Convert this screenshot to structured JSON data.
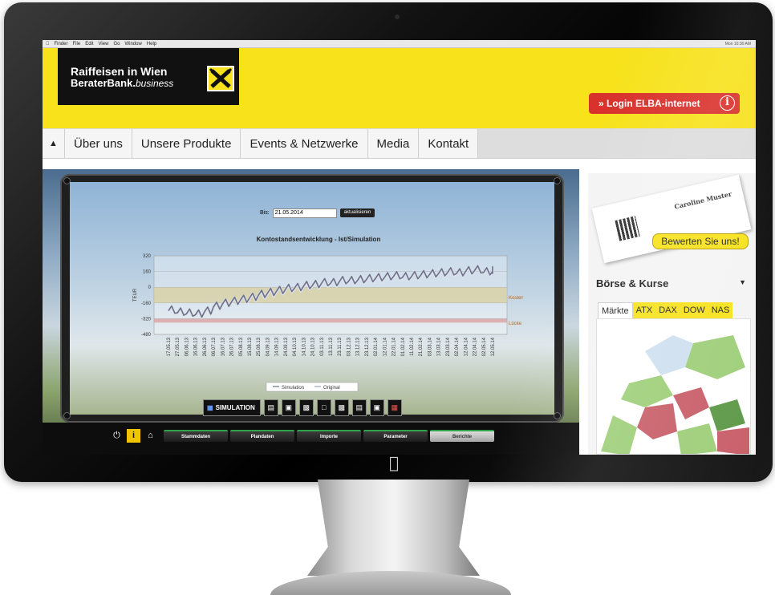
{
  "menubar": {
    "items": [
      "Finder",
      "File",
      "Edit",
      "View",
      "Go",
      "Window",
      "Help"
    ],
    "status": "Mon 10:30 AM"
  },
  "header": {
    "logo_line1": "Raiffeisen in Wien",
    "logo_line2_bold": "BeraterBank.",
    "logo_line2_italic": "business",
    "login_label": "» Login ELBA-internet",
    "info_icon": "i"
  },
  "nav": {
    "home_icon": "home-icon",
    "items": [
      "Über uns",
      "Unsere Produkte",
      "Events & Netzwerke",
      "Media",
      "Kontakt"
    ]
  },
  "simulation": {
    "date_label": "Bis:",
    "date_value": "21.05.2014",
    "update_label": "aktualisieren",
    "sim_button_label": "SIMULATION",
    "tabs": [
      "Stammdaten",
      "Plandaten",
      "Importe",
      "Parameter",
      "Berichte"
    ],
    "active_tab": "Berichte"
  },
  "chart_data": {
    "type": "line",
    "title": "Kontostandsentwicklung - Ist/Simulation",
    "ylabel": "TEUR",
    "xlabel": "",
    "ylim": [
      -480,
      320
    ],
    "yticks": [
      320,
      160,
      0,
      -160,
      -320,
      -480
    ],
    "x": [
      "17.05.13",
      "27.05.13",
      "06.06.13",
      "16.06.13",
      "26.06.13",
      "06.07.13",
      "16.07.13",
      "26.07.13",
      "05.08.13",
      "15.08.13",
      "25.08.13",
      "04.09.13",
      "14.09.13",
      "24.09.13",
      "04.10.13",
      "14.10.13",
      "24.10.13",
      "03.11.13",
      "13.11.13",
      "23.11.13",
      "03.12.13",
      "13.12.13",
      "23.12.13",
      "02.01.14",
      "12.01.14",
      "22.01.14",
      "01.02.14",
      "11.02.14",
      "21.02.14",
      "03.03.14",
      "13.03.14",
      "23.03.14",
      "02.04.14",
      "12.04.14",
      "22.04.14",
      "02.05.14",
      "12.05.14"
    ],
    "series": [
      {
        "name": "Simulation",
        "values": [
          -240,
          -260,
          -270,
          -280,
          -250,
          -200,
          -170,
          -150,
          -130,
          -110,
          -80,
          -60,
          -40,
          -20,
          -10,
          10,
          20,
          40,
          40,
          60,
          60,
          70,
          80,
          90,
          100,
          110,
          100,
          110,
          120,
          130,
          140,
          150,
          140,
          160,
          170,
          150,
          160
        ]
      },
      {
        "name": "Original",
        "values": [
          -245,
          -265,
          -275,
          -285,
          -255,
          -205,
          -175,
          -155,
          -135,
          -115,
          -85,
          -65,
          -45,
          -25,
          -15,
          5,
          15,
          35,
          35,
          55,
          55,
          65,
          75,
          85,
          95,
          105,
          95,
          105,
          115,
          125,
          135,
          145,
          135,
          155,
          165,
          145,
          155
        ]
      }
    ],
    "bands": [
      {
        "label": "Kosten",
        "from": -160,
        "to": 0,
        "color": "#d9c98a"
      },
      {
        "label": "Lücke",
        "from": -360,
        "to": -320,
        "color": "#d98a8a"
      }
    ],
    "grid": true,
    "legend": "bottom"
  },
  "right": {
    "rate_label": "Bewerten Sie uns!",
    "card_name": "Caroline Muster",
    "boerse_title": "Börse & Kurse",
    "boerse_tabs": [
      "Märkte",
      "ATX",
      "DAX",
      "DOW",
      "NAS"
    ],
    "active_boerse_tab": "Märkte"
  },
  "colors": {
    "brand_yellow": "#f7e21c",
    "login_red": "#d9322c",
    "series_line": "#5a5f73"
  }
}
